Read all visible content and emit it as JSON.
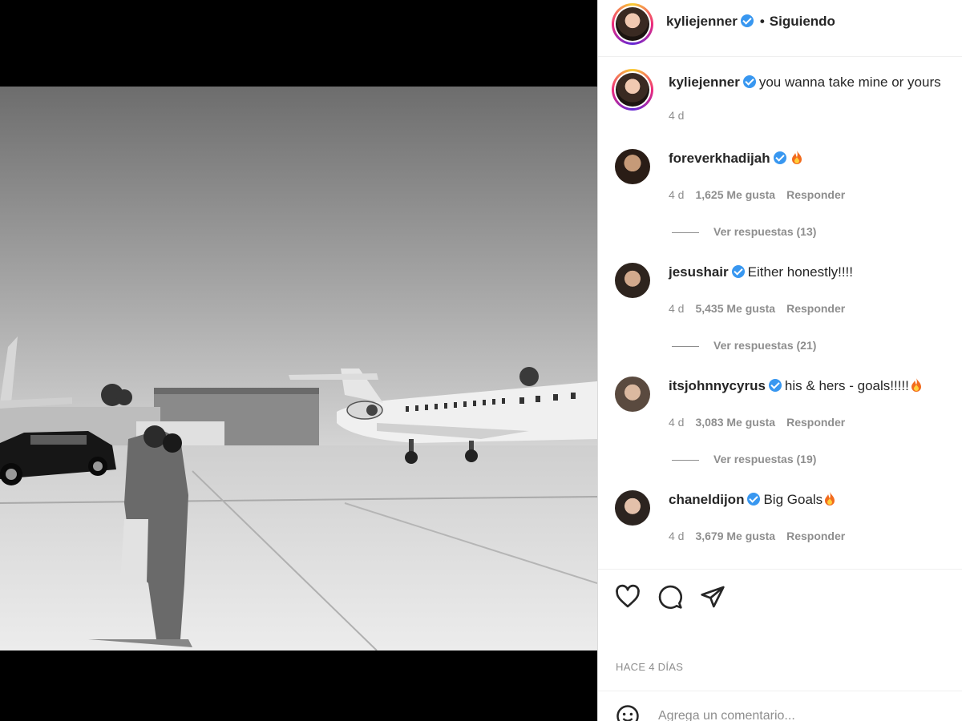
{
  "post": {
    "author": "kyliejenner",
    "follow_status": "Siguiendo",
    "separator": "•",
    "caption": "you wanna take mine or yours",
    "caption_time": "4 d",
    "posted": "HACE 4 DÍAS"
  },
  "comments": [
    {
      "user": "foreverkhadijah",
      "text": "",
      "time": "4 d",
      "likes": "1,625 Me gusta",
      "reply": "Responder",
      "view_replies": "Ver respuestas (13)"
    },
    {
      "user": "jesushair",
      "text": "Either honestly!!!!",
      "time": "4 d",
      "likes": "5,435 Me gusta",
      "reply": "Responder",
      "view_replies": "Ver respuestas (21)"
    },
    {
      "user": "itsjohnnycyrus",
      "text": "his & hers - goals!!!!!",
      "time": "4 d",
      "likes": "3,083 Me gusta",
      "reply": "Responder",
      "view_replies": "Ver respuestas (19)"
    },
    {
      "user": "chaneldijon",
      "text": "Big Goals",
      "time": "4 d",
      "likes": "3,679 Me gusta",
      "reply": "Responder"
    }
  ],
  "add_comment": {
    "placeholder": "Agrega un comentario..."
  },
  "icons": {
    "verified": "verified-badge-icon",
    "like": "heart-icon",
    "comment": "comment-bubble-icon",
    "share": "paper-plane-icon",
    "emoji": "emoji-icon",
    "fire": "fire-emoji"
  },
  "colors": {
    "verified": "#3897f0",
    "text": "#262626",
    "muted": "#8e8e8e"
  }
}
